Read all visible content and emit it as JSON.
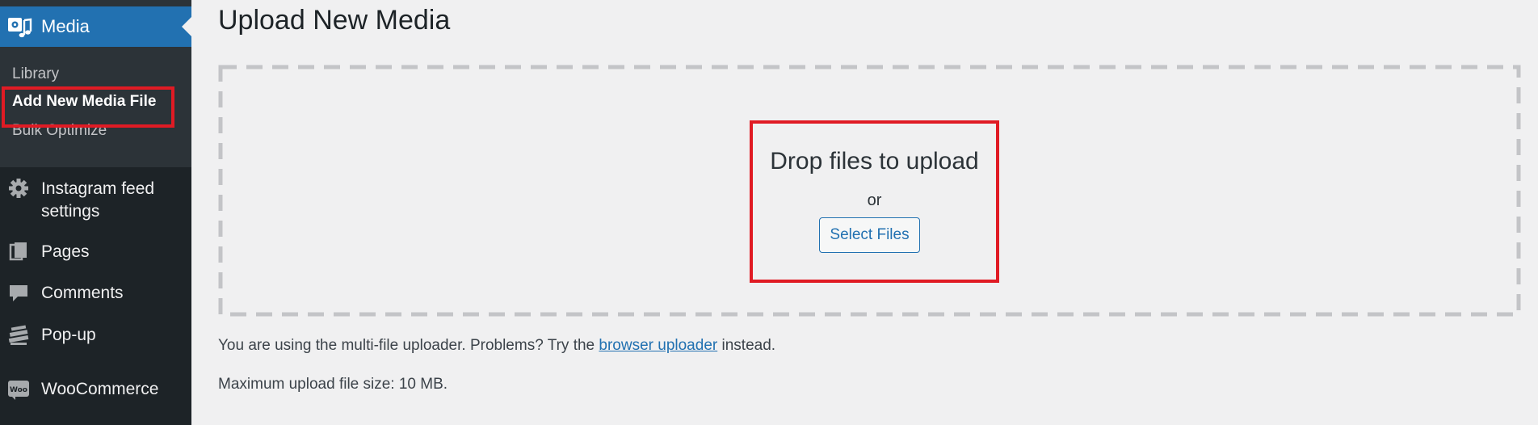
{
  "sidebar": {
    "current_menu": {
      "label": "Media",
      "icon": "media-icon"
    },
    "submenu": [
      {
        "label": "Library"
      },
      {
        "label": "Add New Media File",
        "current": true
      },
      {
        "label": "Bulk Optimize"
      }
    ],
    "menu_items": [
      {
        "label_line1": "Instagram feed",
        "label_line2": "settings",
        "icon": "gear-icon"
      },
      {
        "label": "Pages",
        "icon": "pages-icon"
      },
      {
        "label": "Comments",
        "icon": "comments-icon"
      },
      {
        "label": "Pop-up",
        "icon": "popup-icon"
      },
      {
        "label": "WooCommerce",
        "icon": "woocommerce-icon",
        "icon_text": "Woo"
      }
    ]
  },
  "main": {
    "title": "Upload New Media",
    "dropzone": {
      "heading": "Drop files to upload",
      "or": "or",
      "button_label": "Select Files"
    },
    "uploader_note": {
      "before": "You are using the multi-file uploader. Problems? Try the ",
      "link": "browser uploader",
      "after": " instead."
    },
    "max_size": "Maximum upload file size: 10 MB."
  },
  "colors": {
    "sidebar_bg": "#1d2327",
    "submenu_bg": "#2c3338",
    "accent": "#2271b1",
    "highlight": "#e01b24",
    "page_bg": "#f0f0f1"
  }
}
